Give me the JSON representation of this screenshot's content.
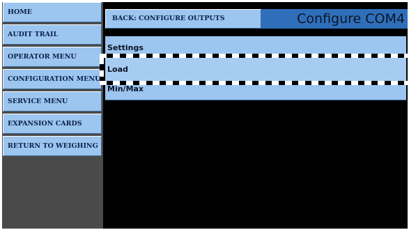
{
  "sidebar": {
    "items": [
      {
        "label": "HOME"
      },
      {
        "label": "AUDIT TRAIL"
      },
      {
        "label": "OPERATOR MENU"
      },
      {
        "label": "CONFIGURATION MENU"
      },
      {
        "label": "SERVICE MENU"
      },
      {
        "label": "EXPANSION CARDS"
      },
      {
        "label": "RETURN TO WEIGHING"
      }
    ]
  },
  "header": {
    "back_label": "BACK: CONFIGURE OUTPUTS",
    "title": "Configure COM4"
  },
  "menu": {
    "items": [
      {
        "label": "Settings"
      },
      {
        "label": "Load",
        "selected": true
      },
      {
        "label": "Min/Max"
      }
    ]
  },
  "colors": {
    "button_bg": "#9cc5ef",
    "title_bg": "#2f6fba",
    "screen_bg": "#000000",
    "sidebar_bg": "#4a4a4a"
  }
}
